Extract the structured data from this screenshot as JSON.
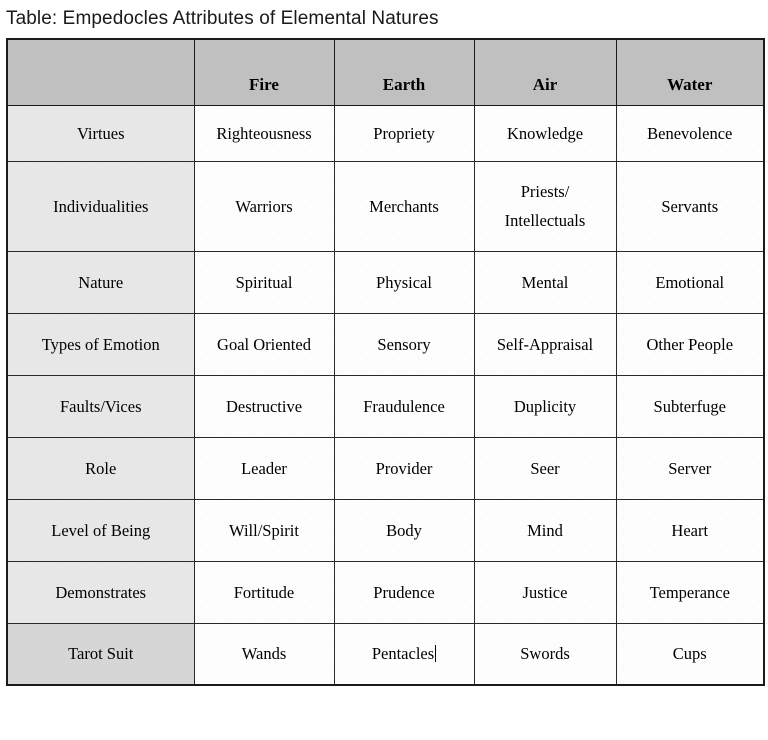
{
  "page": {
    "title": "Table: Empedocles Attributes of Elemental Natures"
  },
  "colors": {
    "header_background": "#c0c0c0",
    "row_label_background": "#e7e7e7",
    "selected_row_label_background": "#d6d6d6",
    "cell_background": "#fdfdfd",
    "border": "#1b1b1b",
    "text": "#000000"
  },
  "table": {
    "corner_label": "",
    "columns": [
      "Fire",
      "Earth",
      "Air",
      "Water"
    ],
    "rows": [
      {
        "label": "Virtues",
        "selected": false,
        "cells": [
          {
            "text": "Righteousness"
          },
          {
            "text": "Propriety"
          },
          {
            "text": "Knowledge"
          },
          {
            "text": "Benevolence"
          }
        ]
      },
      {
        "label": "Individualities",
        "selected": false,
        "cells": [
          {
            "text": "Warriors"
          },
          {
            "text": "Merchants"
          },
          {
            "text": "Priests/ Intellectuals",
            "line1": "Priests/",
            "line2": "Intellectuals"
          },
          {
            "text": "Servants"
          }
        ]
      },
      {
        "label": "Nature",
        "selected": false,
        "cells": [
          {
            "text": "Spiritual"
          },
          {
            "text": "Physical"
          },
          {
            "text": "Mental"
          },
          {
            "text": "Emotional"
          }
        ]
      },
      {
        "label": "Types of Emotion",
        "selected": false,
        "cells": [
          {
            "text": "Goal Oriented"
          },
          {
            "text": "Sensory"
          },
          {
            "text": "Self-Appraisal"
          },
          {
            "text": "Other People"
          }
        ]
      },
      {
        "label": "Faults/Vices",
        "selected": false,
        "cells": [
          {
            "text": "Destructive"
          },
          {
            "text": "Fraudulence"
          },
          {
            "text": "Duplicity"
          },
          {
            "text": "Subterfuge"
          }
        ]
      },
      {
        "label": "Role",
        "selected": false,
        "cells": [
          {
            "text": "Leader"
          },
          {
            "text": "Provider"
          },
          {
            "text": "Seer"
          },
          {
            "text": "Server"
          }
        ]
      },
      {
        "label": "Level of Being",
        "selected": false,
        "cells": [
          {
            "text": "Will/Spirit"
          },
          {
            "text": "Body"
          },
          {
            "text": "Mind"
          },
          {
            "text": "Heart"
          }
        ]
      },
      {
        "label": "Demonstrates",
        "selected": false,
        "cells": [
          {
            "text": "Fortitude"
          },
          {
            "text": "Prudence"
          },
          {
            "text": "Justice"
          },
          {
            "text": "Temperance"
          }
        ]
      },
      {
        "label": "Tarot Suit",
        "selected": true,
        "cells": [
          {
            "text": "Wands"
          },
          {
            "text": "Pentacles",
            "caret": true
          },
          {
            "text": "Swords"
          },
          {
            "text": "Cups"
          }
        ]
      }
    ]
  }
}
